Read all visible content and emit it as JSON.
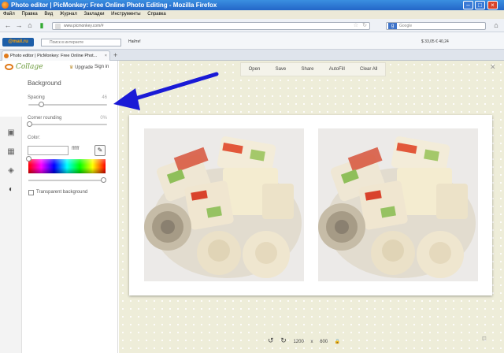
{
  "window": {
    "title": "Photo editor | PicMonkey: Free Online Photo Editing - Mozilla Firefox"
  },
  "menu": [
    "Файл",
    "Правка",
    "Вид",
    "Журнал",
    "Закладки",
    "Инструменты",
    "Справка"
  ],
  "nav": {
    "url": "www.picmonkey.com/#",
    "search_placeholder": "Google"
  },
  "toolbar": {
    "brand_main": "@mail",
    "brand_suffix": ".ru",
    "search_placeholder": "Поиск в интернете",
    "find": "Найти!",
    "right_info": "$ 33,05   € 40,24"
  },
  "tab": {
    "title": "Photo editor | PicMonkey: Free Online Phot...",
    "new_tab": "+"
  },
  "sidebar": {
    "logo": "Collage",
    "upgrade": "Upgrade",
    "signin": "Sign in",
    "section": "Background",
    "spacing": {
      "label": "Spacing",
      "value": "46"
    },
    "corner": {
      "label": "Corner rounding",
      "value": "0%"
    },
    "color": {
      "label": "Color:",
      "hex": "ffffff"
    },
    "transparent_label": "Transparent background",
    "icons": [
      "image-icon",
      "layout-icon",
      "tags-icon",
      "palette-icon"
    ]
  },
  "editor": {
    "buttons": [
      "Open",
      "Save",
      "Share",
      "AutoFill",
      "Clear All"
    ],
    "size_w": "1200",
    "size_x": "x",
    "size_h": "600"
  },
  "colors": {
    "arrow": "#1a1ad6",
    "workspace": "#eeedd9"
  }
}
